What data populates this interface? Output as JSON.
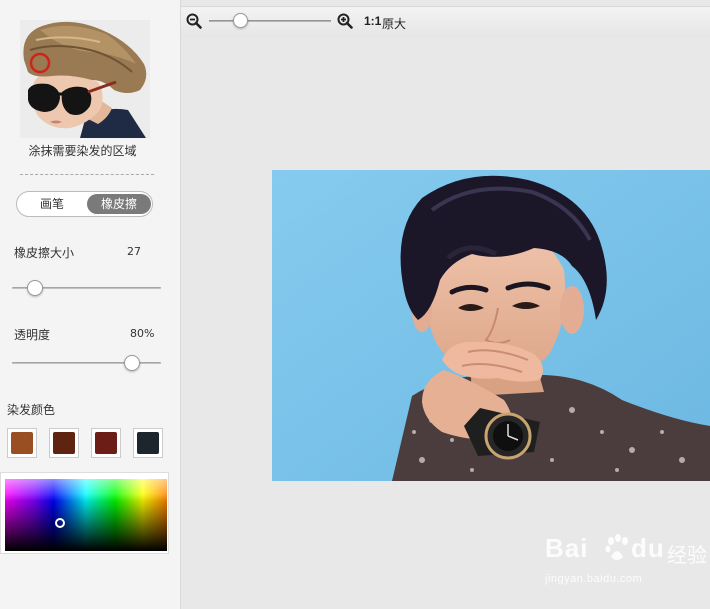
{
  "left_panel": {
    "sample_caption": "涂抹需要染发的区域",
    "tools": {
      "pen_label": "画笔",
      "eraser_label": "橡皮擦",
      "active": "eraser"
    },
    "eraser_size": {
      "label": "橡皮擦大小",
      "value": "27",
      "fraction": 0.15
    },
    "opacity": {
      "label": "透明度",
      "value": "80%",
      "fraction": 0.8
    },
    "hair_color": {
      "label": "染发颜色",
      "swatches": [
        "#9a4f22",
        "#5e2410",
        "#6b1d16",
        "#1d252d"
      ]
    },
    "picker": {
      "selected_hue": "blue"
    }
  },
  "toolbar": {
    "zoom_out_icon": "zoom-out-icon",
    "zoom_in_icon": "zoom-in-icon",
    "zoom_fraction": 0.2,
    "ratio": "1:1",
    "original_size_label": "原大"
  },
  "canvas": {
    "background": "#7ec4ea"
  },
  "watermark": {
    "brand": "Bai",
    "brand2": "du",
    "jingyan": "经验",
    "url": "jingyan.baidu.com"
  }
}
